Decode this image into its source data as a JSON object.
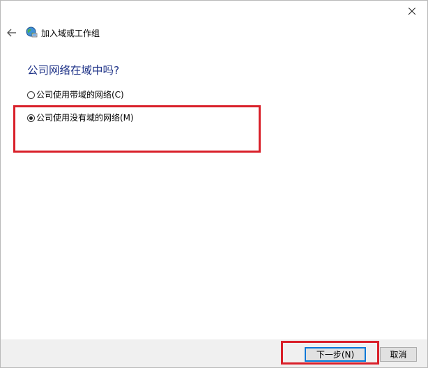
{
  "window": {
    "title": "加入域或工作组",
    "close_icon": "close-icon",
    "back_icon": "back-arrow-icon",
    "app_icon": "network-globe-icon"
  },
  "content": {
    "heading": "公司网络在域中吗?",
    "options": [
      {
        "label": "公司使用带域的网络(C)",
        "selected": false
      },
      {
        "label": "公司使用没有域的网络(M)",
        "selected": true
      }
    ]
  },
  "footer": {
    "next_label": "下一步(N)",
    "cancel_label": "取消"
  },
  "colors": {
    "heading": "#1e3287",
    "highlight": "#d9202a",
    "footer_bg": "#f0f0f0",
    "button_focus": "#0078d7"
  }
}
